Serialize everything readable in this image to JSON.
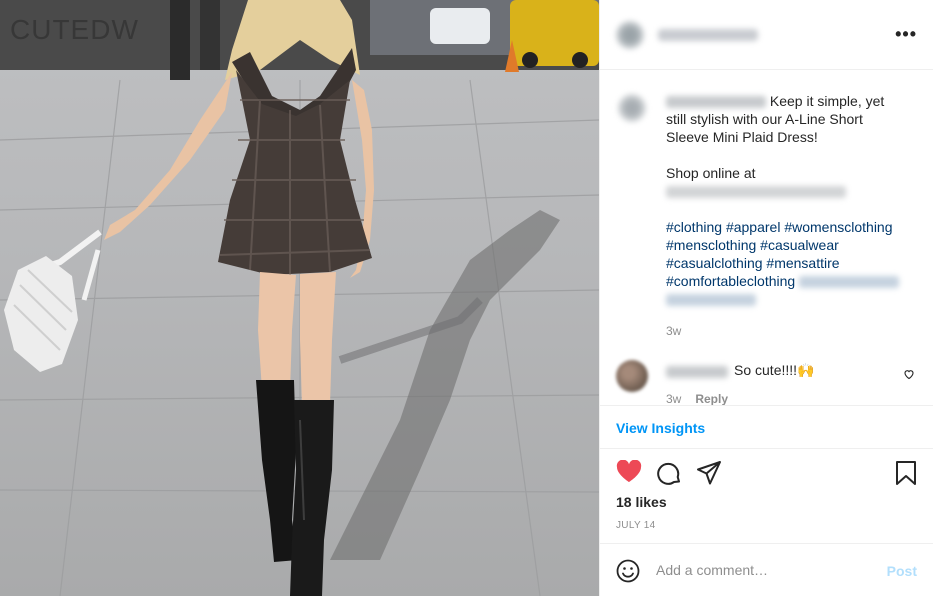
{
  "photo": {
    "watermark": "CUTEDW"
  },
  "post": {
    "header": {
      "more_icon": "more-horizontal-icon"
    },
    "caption": {
      "line1": "Keep it simple, yet",
      "line2": "still stylish with our A-Line Short",
      "line3": "Sleeve Mini Plaid Dress!",
      "shop": "Shop online at",
      "hashtags": [
        "#clothing",
        "#apparel",
        "#womensclothing",
        "#mensclothing",
        "#casualwear",
        "#casualclothing",
        "#mensattire",
        "#comfortableclothing"
      ],
      "time": "3w"
    },
    "comment": {
      "text": "So cute!!!!🙌",
      "time": "3w",
      "reply": "Reply"
    },
    "insights": "View Insights",
    "likes": "18 likes",
    "date": "JULY 14",
    "add_comment": {
      "placeholder": "Add a comment…",
      "post_label": "Post"
    },
    "colors": {
      "heart": "#ed4956",
      "link": "#0095f6",
      "hashtag": "#00376b",
      "post_disabled": "#b2dffc"
    }
  }
}
